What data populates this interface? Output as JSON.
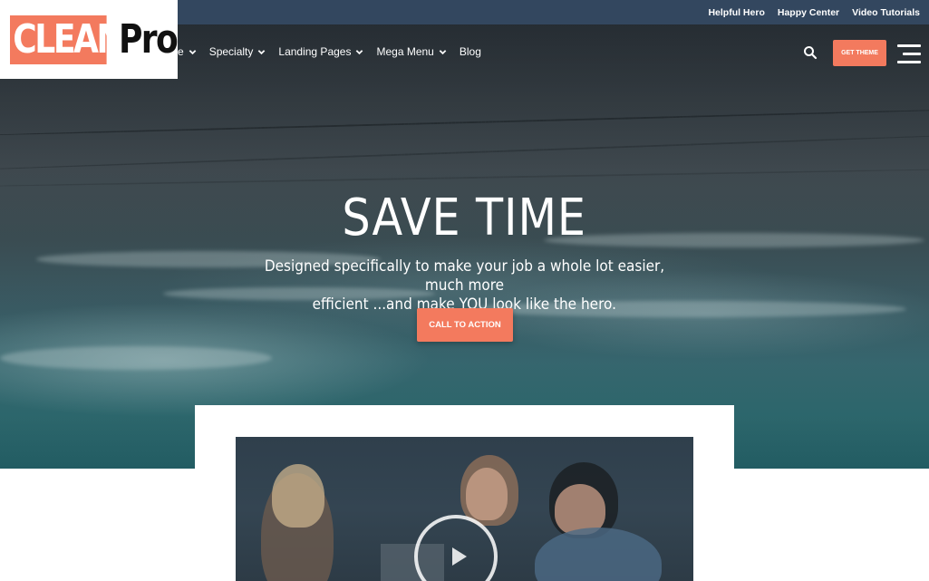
{
  "logo": {
    "part1": "CLEAN",
    "part2": "Pro"
  },
  "topbar": {
    "links": [
      "Helpful Hero",
      "Happy Center",
      "Video Tutorials"
    ]
  },
  "nav": {
    "items": [
      {
        "label": "e",
        "has_dropdown": true
      },
      {
        "label": "Specialty",
        "has_dropdown": true
      },
      {
        "label": "Landing Pages",
        "has_dropdown": true
      },
      {
        "label": "Mega Menu",
        "has_dropdown": true
      },
      {
        "label": "Blog",
        "has_dropdown": false
      }
    ],
    "search_icon": "search-icon",
    "cta_label": "GET THEME",
    "menu_icon": "hamburger-menu-icon"
  },
  "hero": {
    "title": "SAVE TIME",
    "subtitle_line1": "Designed specifically to make your job a whole lot easier, much more",
    "subtitle_line2": "efficient ...and make YOU look like the hero.",
    "cta_label": "CALL TO ACTION"
  },
  "video": {
    "play_icon": "play-icon"
  },
  "colors": {
    "accent": "#f37a5e",
    "topbar": "#33475f",
    "text_light": "#ffffff",
    "logo_dark": "#111111"
  }
}
